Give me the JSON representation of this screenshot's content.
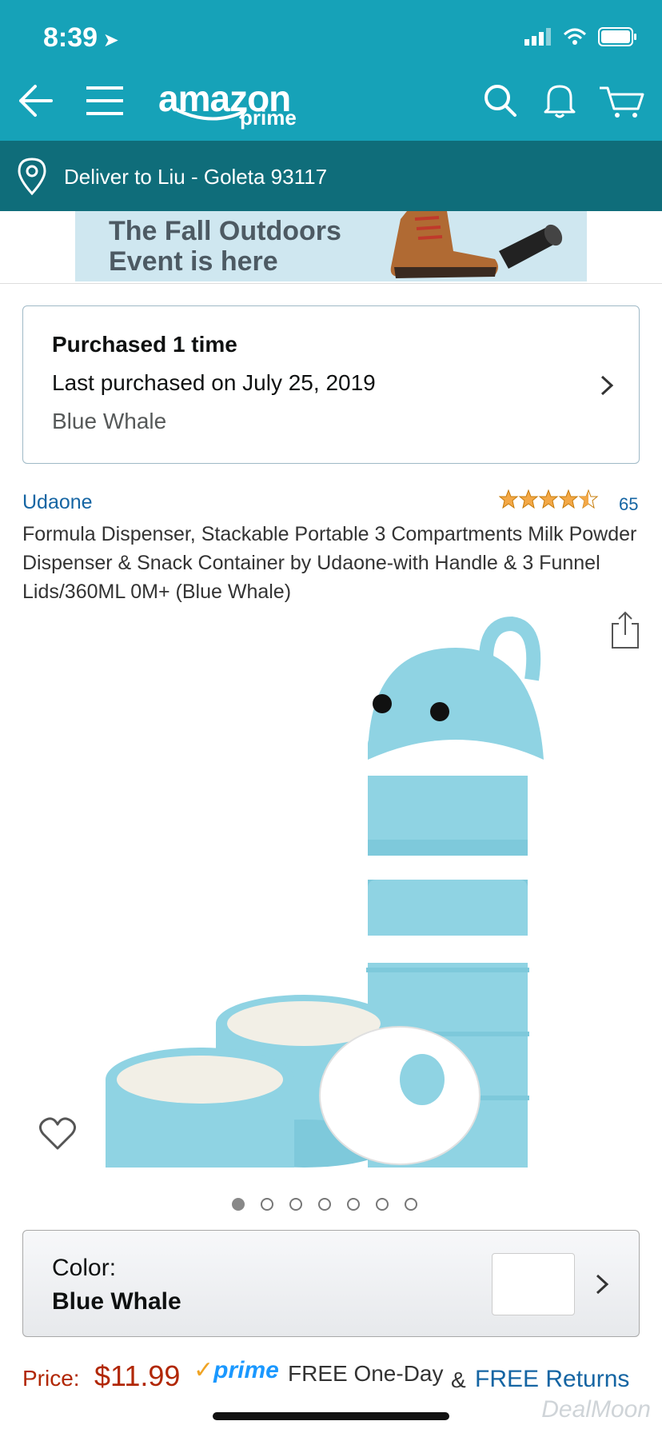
{
  "status_bar": {
    "time": "8:39"
  },
  "header": {
    "logo_text": "amazon",
    "logo_sub": "prime",
    "icons": [
      "back-arrow-icon",
      "menu-icon",
      "search-icon",
      "bell-icon",
      "cart-icon"
    ]
  },
  "delivery": {
    "text": "Deliver to Liu - Goleta 93117",
    "icon": "location-pin-icon"
  },
  "banner": {
    "line1": "The Fall Outdoors",
    "line2": "Event is here"
  },
  "purchase_history": {
    "title": "Purchased 1 time",
    "last_purchased": "Last purchased on July 25, 2019",
    "variant": "Blue Whale"
  },
  "product": {
    "brand": "Udaone",
    "rating_stars": 4.5,
    "rating_count": "65",
    "title": "Formula Dispenser, Stackable Portable 3 Compartments Milk Powder Dispenser & Snack Container by Udaone-with Handle & 3 Funnel Lids/360ML 0M+ (Blue Whale)"
  },
  "gallery": {
    "image_count": 7,
    "active_index": 0
  },
  "color_selector": {
    "label": "Color:",
    "value": "Blue Whale"
  },
  "price": {
    "label": "Price:",
    "value": "$11.99",
    "prime_label": "prime",
    "shipping": "FREE One-Day",
    "amp": "&",
    "returns": "FREE Returns"
  },
  "watermark": "DealMoon",
  "colors": {
    "header": "#16a2b8",
    "deliver_bar": "#0f6d7a",
    "price": "#b12704",
    "link": "#1565a3"
  }
}
